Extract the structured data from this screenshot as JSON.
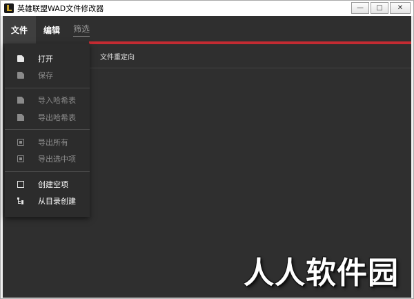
{
  "window": {
    "title": "英雄联盟WAD文件修改器",
    "controls": {
      "minimize": "—",
      "maximize": "□",
      "close": "✕"
    }
  },
  "menubar": {
    "items": [
      {
        "label": "文件",
        "active": true
      },
      {
        "label": "编辑",
        "active": false
      },
      {
        "label": "筛选",
        "active": false
      }
    ]
  },
  "main": {
    "header_text": "文件重定向"
  },
  "dropdown": {
    "items": [
      {
        "label": "打开",
        "icon": "file-icon",
        "enabled": true
      },
      {
        "label": "保存",
        "icon": "save-file-icon",
        "enabled": false
      },
      {
        "label": "导入哈希表",
        "icon": "import-list-icon",
        "enabled": false
      },
      {
        "label": "导出哈希表",
        "icon": "export-list-icon",
        "enabled": false
      },
      {
        "label": "导出所有",
        "icon": "export-all-icon",
        "enabled": false
      },
      {
        "label": "导出选中项",
        "icon": "export-selected-icon",
        "enabled": false
      },
      {
        "label": "创建空项",
        "icon": "empty-square-icon",
        "enabled": true
      },
      {
        "label": "从目录创建",
        "icon": "folder-tree-icon",
        "enabled": true
      }
    ]
  },
  "watermark": "人人软件园",
  "colors": {
    "background": "#2f2f2f",
    "accent": "#c42b32",
    "menu_active": "#3f3f3f",
    "text": "#ffffff",
    "disabled_text": "#8c8c8c"
  }
}
